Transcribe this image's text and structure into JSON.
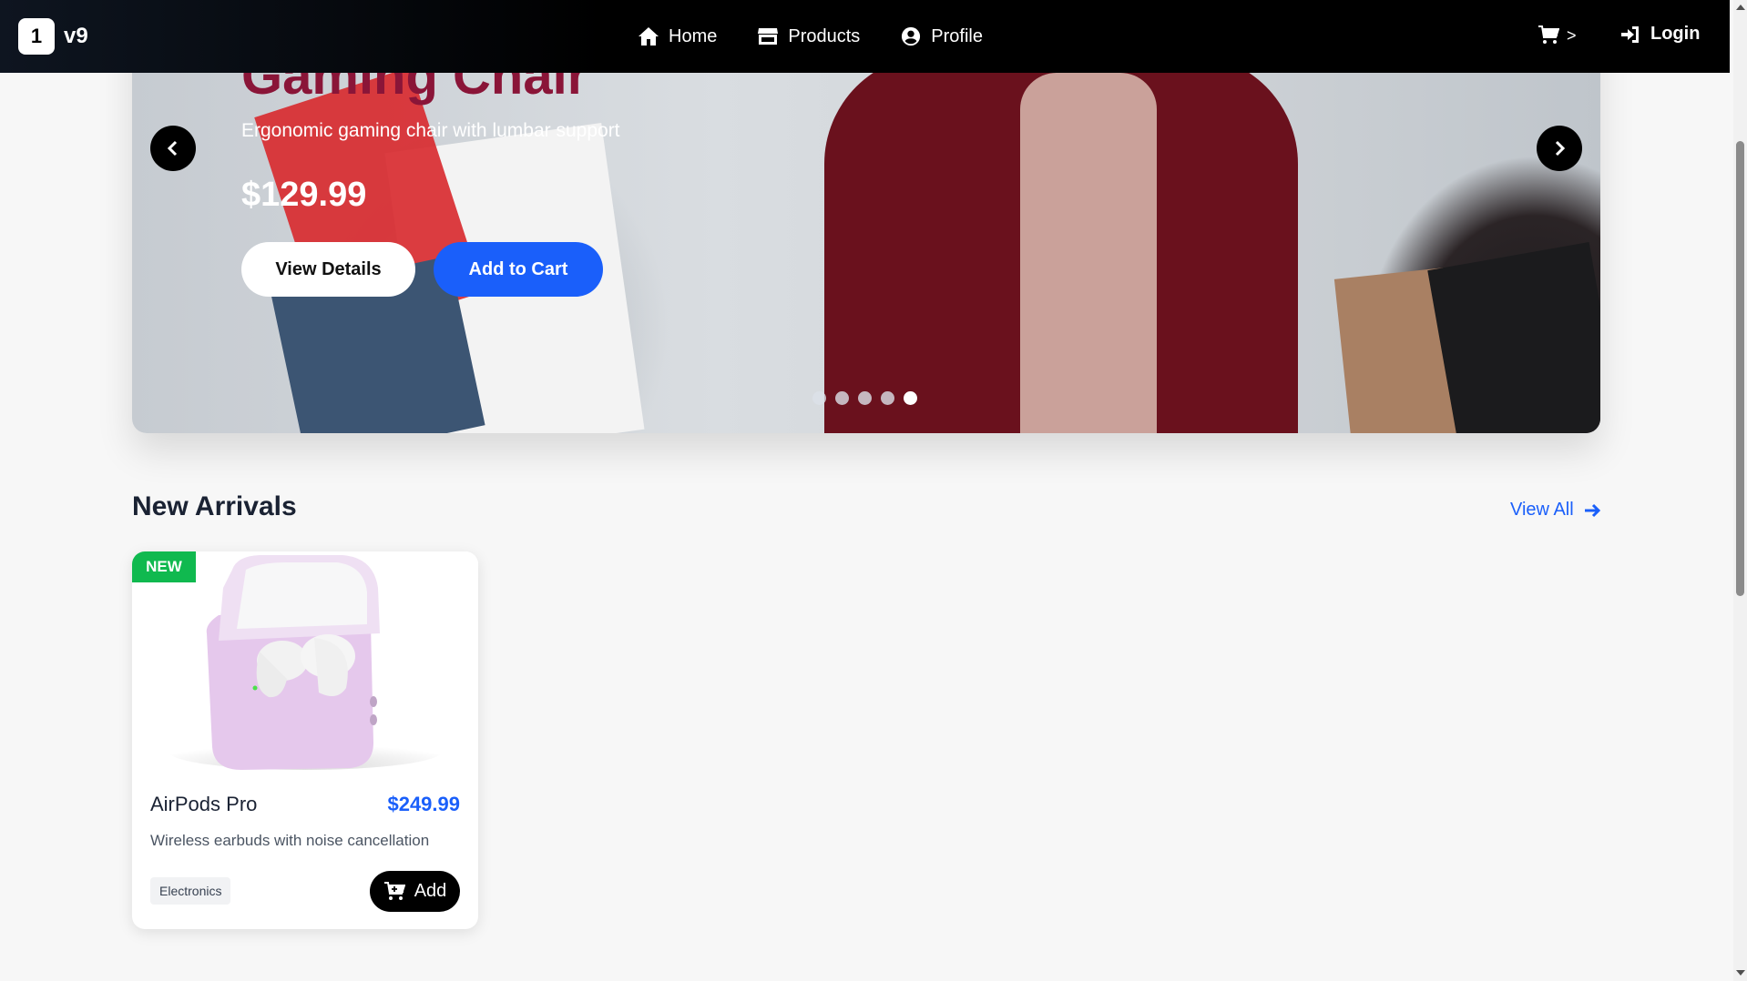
{
  "nav": {
    "logo_mark": "1",
    "logo_text": "v9",
    "links": [
      {
        "label": "Home",
        "icon": "home-icon"
      },
      {
        "label": "Products",
        "icon": "store-icon"
      },
      {
        "label": "Profile",
        "icon": "user-circle-icon"
      }
    ],
    "cart_label": ">",
    "login_label": "Login"
  },
  "hero": {
    "title": "Gaming Chair",
    "subtitle": "Ergonomic gaming chair with lumbar support",
    "price": "$129.99",
    "view_details_label": "View Details",
    "add_to_cart_label": "Add to Cart",
    "slide_count": 5,
    "active_slide": 5
  },
  "new_arrivals": {
    "title": "New Arrivals",
    "view_all_label": "View All",
    "products": [
      {
        "badge": "NEW",
        "name": "AirPods Pro",
        "price": "$249.99",
        "description": "Wireless earbuds with noise cancellation",
        "category": "Electronics",
        "add_label": "Add"
      }
    ]
  },
  "colors": {
    "accent_blue": "#1a5ffa",
    "badge_green": "#10b94f",
    "hero_title": "#8a1538"
  }
}
